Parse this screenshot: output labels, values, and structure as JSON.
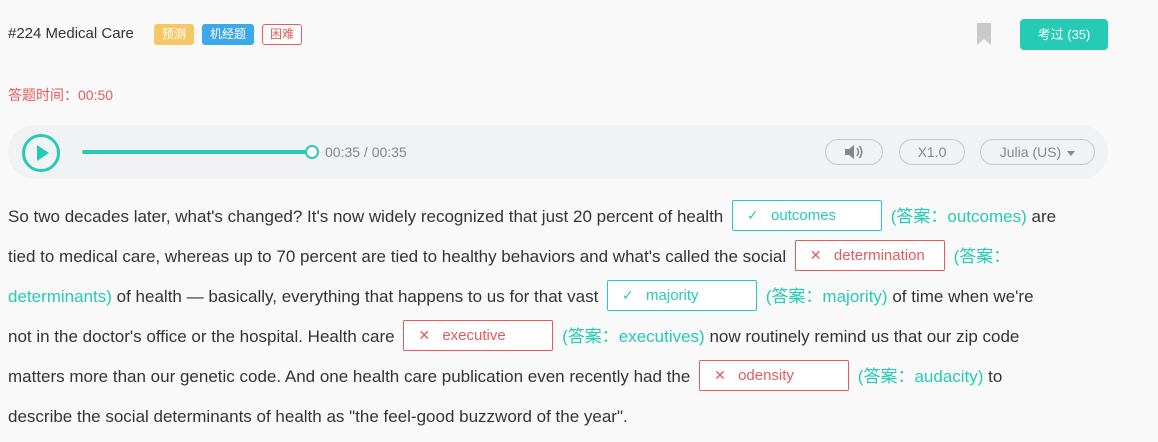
{
  "header": {
    "title": "#224 Medical Care",
    "tags": {
      "predict": "预测",
      "jijing": "机经题",
      "difficulty": "困难"
    },
    "exam_button": "考过 (35)"
  },
  "timer": {
    "text": "答题时间：00:50"
  },
  "player": {
    "time": "00:35 / 00:35",
    "progress": 1.0,
    "speed": "X1.0",
    "voice": "Julia (US)"
  },
  "colors": {
    "accent": "#26cbb5",
    "error": "#e85a5a",
    "predict_tag": "#f7c765",
    "jijing_tag": "#3fa8e8"
  },
  "passage": {
    "l1": {
      "t1": "So two decades later, what's changed? It's now widely recognized that just 20 percent of health",
      "b1_mark": "✓",
      "b1": "outcomes",
      "a1": "(答案：outcomes)",
      "t2": " are"
    },
    "l2": {
      "t1": "tied to medical care, whereas up to 70 percent are tied to healthy behaviors and what's called the social",
      "b1_mark": "✕",
      "b1": "determination",
      "a1": "(答案："
    },
    "l3": {
      "a0": "determinants)",
      "t1": " of health — basically, everything that happens to us for that vast",
      "b1_mark": "✓",
      "b1": "majority",
      "a1": "(答案：majority)",
      "t2": " of time when we're"
    },
    "l4": {
      "t1": "not in the doctor's office or the hospital. Health care",
      "b1_mark": "✕",
      "b1": "executive",
      "a1": "(答案：executives)",
      "t2": " now routinely remind us that our zip code"
    },
    "l5": {
      "t1": "matters more than our genetic code. And one health care publication even recently had the",
      "b1_mark": "✕",
      "b1": "odensity",
      "a1": "(答案：audacity)",
      "t2": " to"
    },
    "l6": {
      "t1": "describe the social determinants of health as \"the feel-good buzzword of the year\"."
    }
  }
}
